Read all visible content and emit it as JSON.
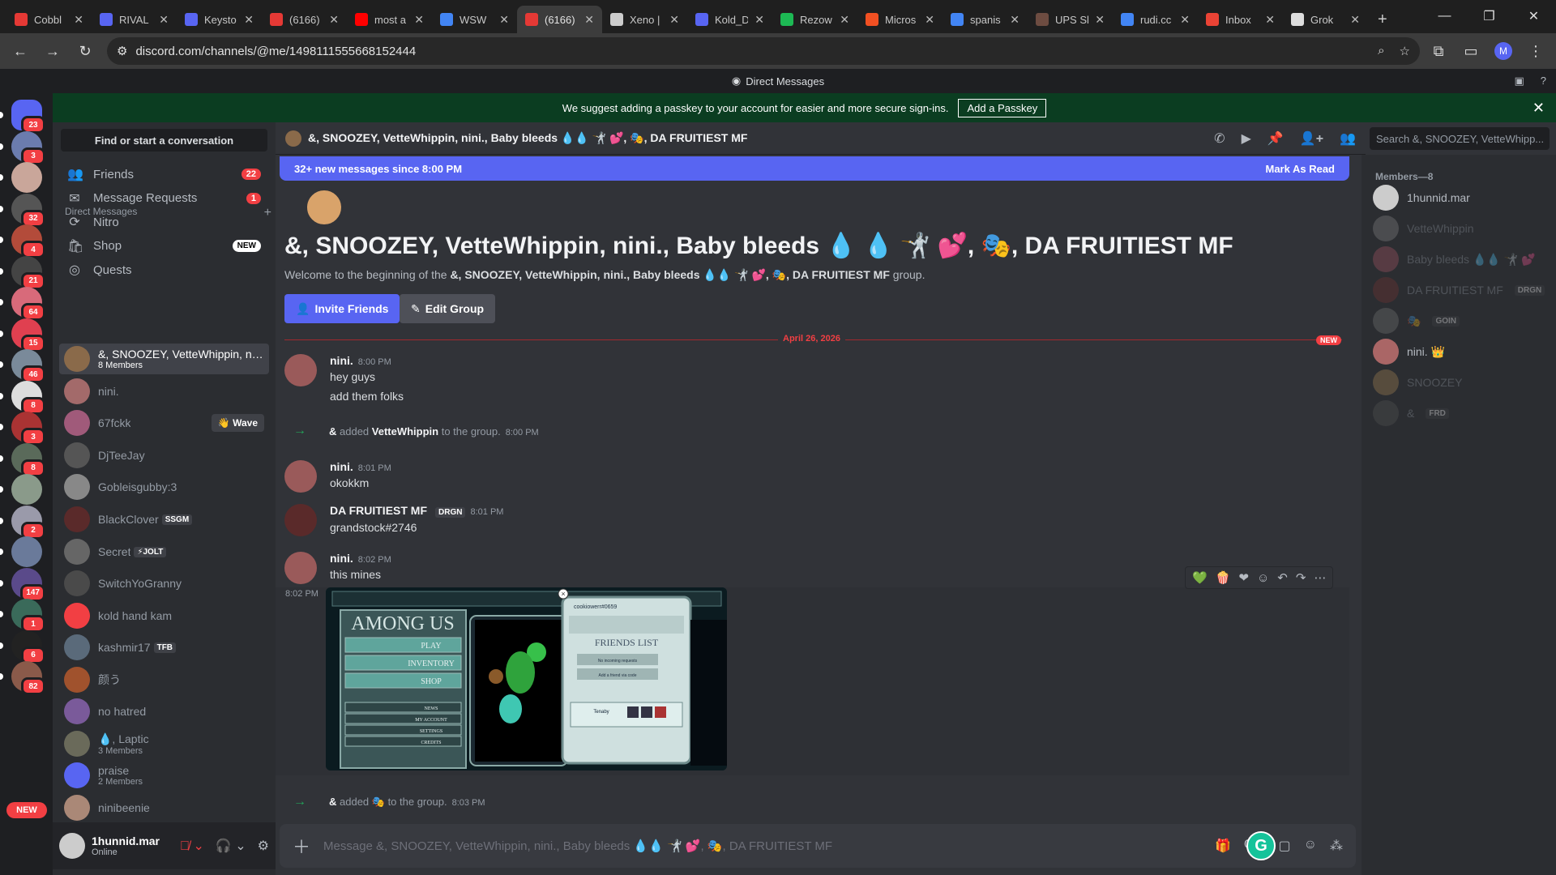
{
  "browser": {
    "tabs": [
      {
        "title": "Cobbl",
        "color": "#e53935"
      },
      {
        "title": "RIVAL",
        "color": "#5865f2"
      },
      {
        "title": "Keysto",
        "color": "#5865f2"
      },
      {
        "title": "(6166)",
        "color": "#e53935"
      },
      {
        "title": "most a",
        "color": "#ff0000"
      },
      {
        "title": "WSW",
        "color": "#4285f4"
      },
      {
        "title": "(6166)",
        "color": "#e53935",
        "active": true
      },
      {
        "title": "Xeno |",
        "color": "#cccccc"
      },
      {
        "title": "Kold_D",
        "color": "#5865f2"
      },
      {
        "title": "Rezow",
        "color": "#1db954"
      },
      {
        "title": "Micros",
        "color": "#f25022"
      },
      {
        "title": "spanis",
        "color": "#4285f4"
      },
      {
        "title": "UPS Sl",
        "color": "#6d4c41"
      },
      {
        "title": "rudi.cc",
        "color": "#4285f4"
      },
      {
        "title": "Inbox",
        "color": "#ea4335"
      },
      {
        "title": "Grok",
        "color": "#dddddd"
      }
    ],
    "url": "discord.com/channels/@me/1498111555668152444",
    "profile_initial": "M"
  },
  "app": {
    "title": "Direct Messages",
    "passkey_text": "We suggest adding a passkey to your account for easier and more secure sign-ins.",
    "passkey_button": "Add a Passkey"
  },
  "guilds": [
    {
      "badge": "23",
      "color": "#5865f2"
    },
    {
      "badge": "3",
      "color": "#6b7cae"
    },
    {
      "badge": "",
      "color": "#c9a69a"
    },
    {
      "badge": "32",
      "color": "#555"
    },
    {
      "badge": "4",
      "color": "#b34b3a"
    },
    {
      "badge": "21",
      "color": "#444"
    },
    {
      "badge": "64",
      "color": "#d86a7a"
    },
    {
      "badge": "15",
      "color": "#e04050"
    },
    {
      "badge": "46",
      "color": "#7a8a9a"
    },
    {
      "badge": "8",
      "color": "#ddd"
    },
    {
      "badge": "3",
      "color": "#a33"
    },
    {
      "badge": "8",
      "color": "#5a6a5a"
    },
    {
      "badge": "",
      "color": "#8a9a8a"
    },
    {
      "badge": "2",
      "color": "#9a9aaa"
    },
    {
      "badge": "",
      "color": "#6a7a9a"
    },
    {
      "badge": "147",
      "color": "#5a4a8a"
    },
    {
      "badge": "1",
      "color": "#3a6a5a"
    },
    {
      "badge": "6",
      "color": "#222"
    },
    {
      "badge": "82",
      "color": "#8a5a4a"
    }
  ],
  "guild_new": "NEW",
  "sidebar": {
    "find": "Find or start a conversation",
    "nav": [
      {
        "icon": "👥",
        "label": "Friends",
        "count": "22"
      },
      {
        "icon": "✉",
        "label": "Message Requests",
        "count": "1"
      },
      {
        "icon": "⟳",
        "label": "Nitro",
        "count": ""
      },
      {
        "icon": "🛍",
        "label": "Shop",
        "new": "NEW"
      },
      {
        "icon": "◎",
        "label": "Quests",
        "count": ""
      }
    ],
    "dm_header": "Direct Messages",
    "dms": [
      {
        "name": "&, SNOOZEY, VetteWhippin, nini...",
        "sub": "8 Members",
        "color": "#8a6a4a",
        "selected": true
      },
      {
        "name": "nini.",
        "color": "#a36a6a"
      },
      {
        "name": "67fckk",
        "color": "#a05a7a",
        "wave": "👋 Wave"
      },
      {
        "name": "DjTeeJay",
        "color": "#555"
      },
      {
        "name": "Gobleisgubby:3",
        "color": "#888"
      },
      {
        "name": "BlackClover",
        "color": "#5a2a2a",
        "tag": "SSGM"
      },
      {
        "name": "Secret",
        "color": "#666",
        "tag": "⚡JOLT"
      },
      {
        "name": "SwitchYoGranny",
        "color": "#4a4a4a"
      },
      {
        "name": "kold hand kam",
        "color": "#f23f43"
      },
      {
        "name": "kashmir17",
        "color": "#5a6a7a",
        "tag": "TFB"
      },
      {
        "name": "颜う",
        "color": "#a0522d"
      },
      {
        "name": "no hatred",
        "color": "#7a5a9a"
      },
      {
        "name": "💧, Laptic",
        "sub": "3 Members",
        "color": "#6a6a5a"
      },
      {
        "name": "praise",
        "sub": "2 Members",
        "color": "#5865f2"
      },
      {
        "name": "ninibeenie",
        "color": "#aa8877"
      }
    ]
  },
  "user": {
    "name": "1hunnid.mar",
    "status": "Online"
  },
  "channel": {
    "header": "&, SNOOZEY, VetteWhippin, nini., Baby bleeds 💧💧 🤺 💕, 🎭, DA FRUITIEST MF",
    "search": "Search &, SNOOZEY, VetteWhipp...",
    "new_messages": "32+ new messages since 8:00 PM",
    "mark_read": "Mark As Read",
    "group_title": "&, SNOOZEY, VetteWhippin, nini., Baby bleeds 💧 💧 🤺 💕, 🎭, DA FRUITIEST MF",
    "welcome_prefix": "Welcome to the beginning of the ",
    "welcome_name": "&, SNOOZEY, VetteWhippin, nini., Baby bleeds 💧💧 🤺 💕, 🎭, DA FRUITIEST MF",
    "welcome_suffix": " group.",
    "invite": "Invite Friends",
    "edit": "Edit Group",
    "date": "April 26, 2026",
    "new_tag": "NEW"
  },
  "messages": [
    {
      "author": "nini.",
      "time": "8:00 PM",
      "lines": [
        "hey guys",
        "add them folks"
      ]
    },
    {
      "system": true,
      "actor": "&",
      "action": " added ",
      "target": "VetteWhippin",
      "tail": " to the group.",
      "time": "8:00 PM"
    },
    {
      "author": "nini.",
      "time": "8:01 PM",
      "lines": [
        "okokkm"
      ]
    },
    {
      "author": "DA FRUITIEST MF",
      "tag": "DRGN",
      "time": "8:01 PM",
      "lines": [
        "grandstock#2746"
      ]
    },
    {
      "author": "nini.",
      "time": "8:02 PM",
      "lines": [
        "this mines"
      ]
    },
    {
      "system": true,
      "actor": "&",
      "action": " added ",
      "target": "🎭",
      "tail": " to the group.",
      "time": "8:03 PM"
    }
  ],
  "attachment_time": "8:02 PM",
  "attachment": {
    "game_title": "AMONG US",
    "menu": [
      "PLAY",
      "INVENTORY",
      "SHOP",
      "NEWS",
      "MY ACCOUNT",
      "SETTINGS",
      "CREDITS"
    ],
    "user_tag": "cookiowerr#0659",
    "friends_title": "FRIENDS LIST",
    "friends_rows": [
      "No incoming requests",
      "Add a friend via code"
    ],
    "friend_name": "Tenaby"
  },
  "composer_placeholder": "Message &, SNOOZEY, VetteWhippin, nini., Baby bleeds 💧💧 🤺 💕, 🎭, DA FRUITIEST MF",
  "members": {
    "header": "Members—8",
    "list": [
      {
        "name": "1hunnid.mar",
        "color": "#ccc",
        "online": true
      },
      {
        "name": "VetteWhippin",
        "color": "#888",
        "online": false
      },
      {
        "name": "Baby bleeds 💧💧 🤺 💕",
        "color": "#a56",
        "online": false
      },
      {
        "name": "DA FRUITIEST MF",
        "tag": "DRGN",
        "color": "#733",
        "online": false
      },
      {
        "name": "🎭",
        "tag": "GOIN",
        "color": "#777",
        "online": false
      },
      {
        "name": "nini. 👑",
        "color": "#a66",
        "online": true
      },
      {
        "name": "SNOOZEY",
        "color": "#a85",
        "online": false
      },
      {
        "name": "&",
        "tag": "FRD",
        "color": "#555",
        "online": false
      }
    ]
  }
}
